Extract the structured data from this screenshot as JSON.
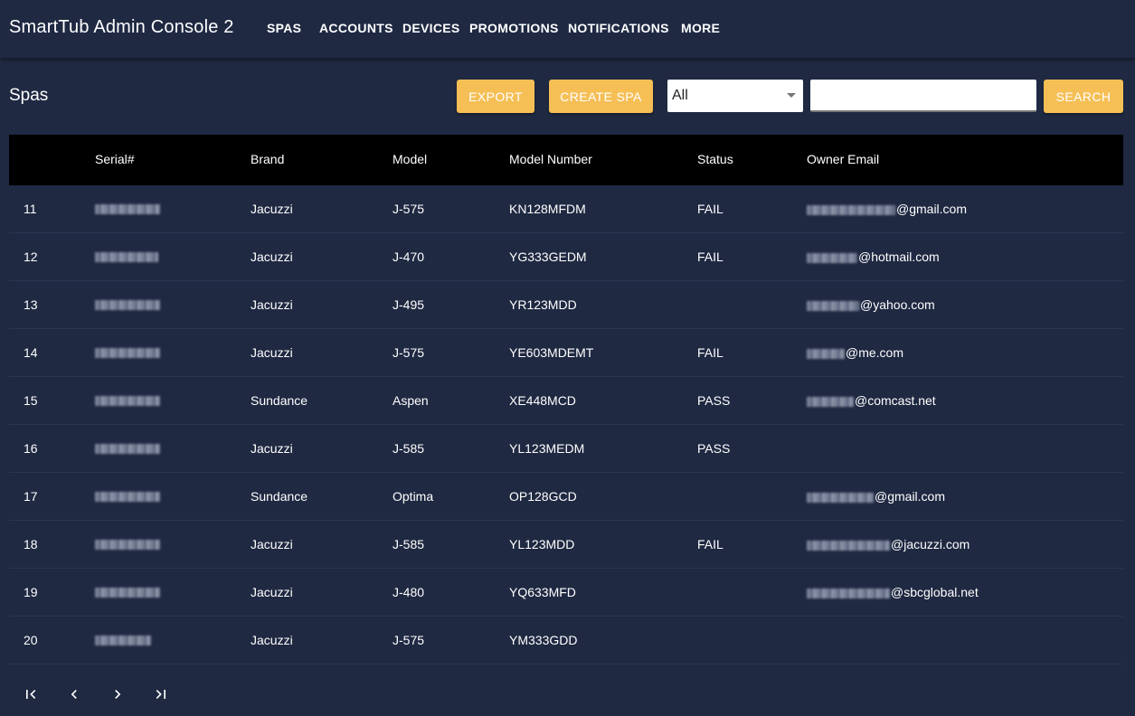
{
  "app": {
    "title": "SmartTub Admin Console 2"
  },
  "nav": [
    {
      "label": "SPAS"
    },
    {
      "label": "ACCOUNTS"
    },
    {
      "label": "DEVICES"
    },
    {
      "label": "PROMOTIONS"
    },
    {
      "label": "NOTIFICATIONS"
    },
    {
      "label": "MORE"
    }
  ],
  "page": {
    "title": "Spas"
  },
  "toolbar": {
    "export_label": "EXPORT",
    "create_label": "CREATE SPA",
    "filter_value": "All",
    "search_value": "",
    "search_label": "SEARCH",
    "accent": "#f5bf56"
  },
  "table": {
    "headers": {
      "serial": "Serial#",
      "brand": "Brand",
      "model": "Model",
      "model_number": "Model Number",
      "status": "Status",
      "owner_email": "Owner Email"
    },
    "rows": [
      {
        "index": "11",
        "brand": "Jacuzzi",
        "model": "J-575",
        "model_number": "KN128MFDM",
        "status": "FAIL",
        "email_domain": "@gmail.com"
      },
      {
        "index": "12",
        "brand": "Jacuzzi",
        "model": "J-470",
        "model_number": "YG333GEDM",
        "status": "FAIL",
        "email_domain": "@hotmail.com"
      },
      {
        "index": "13",
        "brand": "Jacuzzi",
        "model": "J-495",
        "model_number": "YR123MDD",
        "status": "",
        "email_domain": "@yahoo.com"
      },
      {
        "index": "14",
        "brand": "Jacuzzi",
        "model": "J-575",
        "model_number": "YE603MDEMT",
        "status": "FAIL",
        "email_domain": "@me.com"
      },
      {
        "index": "15",
        "brand": "Sundance",
        "model": "Aspen",
        "model_number": "XE448MCD",
        "status": "PASS",
        "email_domain": "@comcast.net"
      },
      {
        "index": "16",
        "brand": "Jacuzzi",
        "model": "J-585",
        "model_number": "YL123MEDM",
        "status": "PASS",
        "email_domain": ""
      },
      {
        "index": "17",
        "brand": "Sundance",
        "model": "Optima",
        "model_number": "OP128GCD",
        "status": "",
        "email_domain": "@gmail.com"
      },
      {
        "index": "18",
        "brand": "Jacuzzi",
        "model": "J-585",
        "model_number": "YL123MDD",
        "status": "FAIL",
        "email_domain": "@jacuzzi.com"
      },
      {
        "index": "19",
        "brand": "Jacuzzi",
        "model": "J-480",
        "model_number": "YQ633MFD",
        "status": "",
        "email_domain": "@sbcglobal.net"
      },
      {
        "index": "20",
        "brand": "Jacuzzi",
        "model": "J-575",
        "model_number": "YM333GDD",
        "status": "",
        "email_domain": ""
      }
    ]
  },
  "pagination": {
    "icons": [
      "first-page-icon",
      "previous-page-icon",
      "next-page-icon",
      "last-page-icon"
    ]
  }
}
